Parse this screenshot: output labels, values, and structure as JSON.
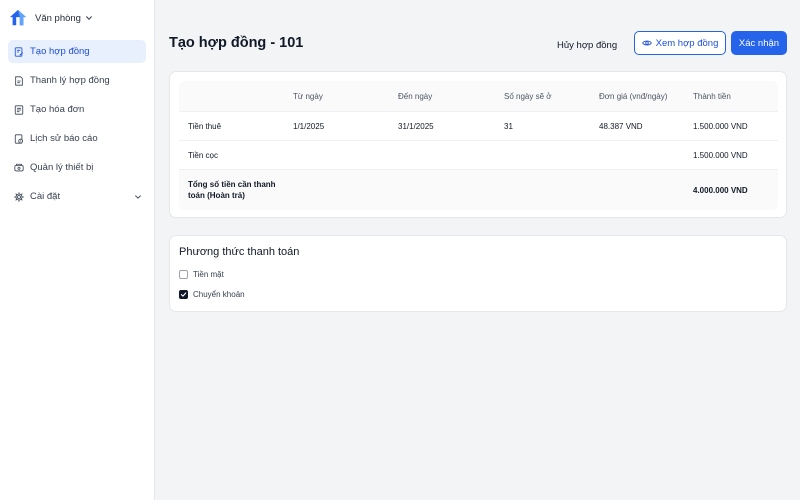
{
  "brand": {
    "name": "Văn phòng",
    "logo_icon": "house-logo-icon",
    "accent": "#2563eb"
  },
  "sidebar": {
    "items": [
      {
        "label": "Tạo hợp đồng",
        "icon": "contract-icon",
        "active": true
      },
      {
        "label": "Thanh lý hợp đồng",
        "icon": "document-icon",
        "active": false
      },
      {
        "label": "Tạo hóa đơn",
        "icon": "invoice-icon",
        "active": false
      },
      {
        "label": "Lịch sử báo cáo",
        "icon": "report-history-icon",
        "active": false
      },
      {
        "label": "Quản lý thiết bị",
        "icon": "device-icon",
        "active": false
      },
      {
        "label": "Cài đặt",
        "icon": "gear-icon",
        "active": false,
        "expandable": true
      }
    ]
  },
  "header": {
    "title": "Tạo hợp đồng - 101",
    "cancel_label": "Hủy hợp đồng",
    "view_label": "Xem hợp đồng",
    "confirm_label": "Xác nhận"
  },
  "table": {
    "columns": [
      "",
      "Từ ngày",
      "Đến ngày",
      "Số ngày sẽ ở",
      "Đơn giá (vnđ/ngày)",
      "Thành tiền"
    ],
    "rows": [
      [
        "Tiền thuê",
        "1/1/2025",
        "31/1/2025",
        "31",
        "48.387 VND",
        "1.500.000 VND"
      ],
      [
        "Tiền cọc",
        "",
        "",
        "",
        "",
        "1.500.000 VND"
      ]
    ],
    "total": {
      "label": "Tổng số tiền cần thanh toán (Hoàn trả)",
      "value": "4.000.000 VND"
    }
  },
  "payment": {
    "title": "Phương thức thanh toán",
    "options": [
      {
        "label": "Tiền mặt",
        "checked": false
      },
      {
        "label": "Chuyển khoản",
        "checked": true
      }
    ]
  }
}
